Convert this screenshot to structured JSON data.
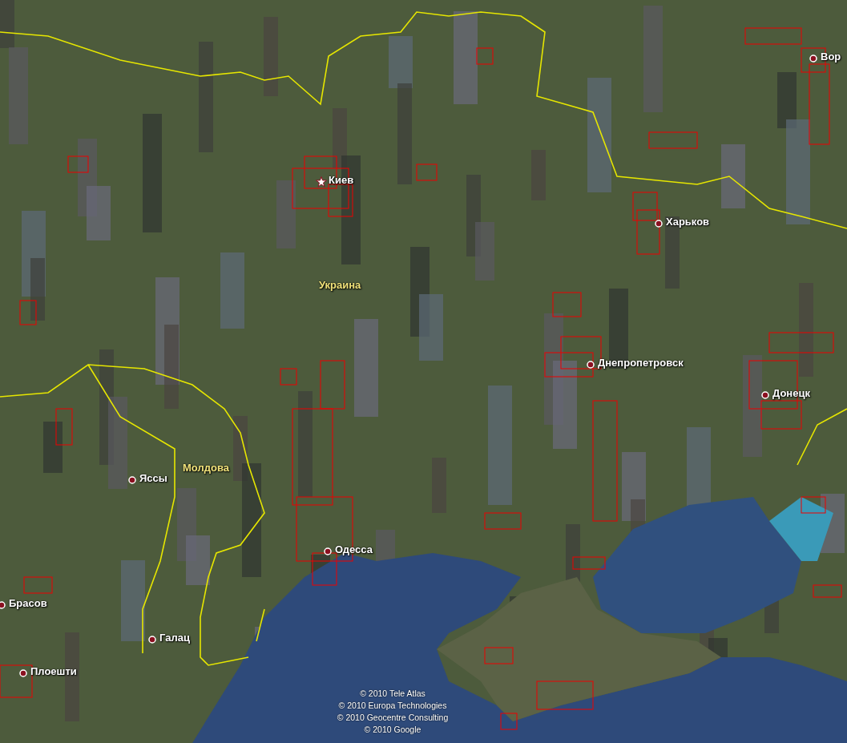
{
  "map": {
    "places": [
      {
        "name": "Вор",
        "kind": "city"
      },
      {
        "name": "Киев",
        "kind": "capital"
      },
      {
        "name": "Харьков",
        "kind": "city"
      },
      {
        "name": "Украина",
        "kind": "country"
      },
      {
        "name": "Днепропетровск",
        "kind": "city"
      },
      {
        "name": "Донецк",
        "kind": "city"
      },
      {
        "name": "Молдова",
        "kind": "country"
      },
      {
        "name": "Яссы",
        "kind": "city"
      },
      {
        "name": "Одесса",
        "kind": "city"
      },
      {
        "name": "Брасов",
        "kind": "city"
      },
      {
        "name": "Галац",
        "kind": "city"
      },
      {
        "name": "Плоешти",
        "kind": "city"
      }
    ],
    "attribution": [
      "© 2010 Tele Atlas",
      "© 2010 Europa Technologies",
      "© 2010 Geocentre Consulting",
      "© 2010 Google"
    ]
  }
}
